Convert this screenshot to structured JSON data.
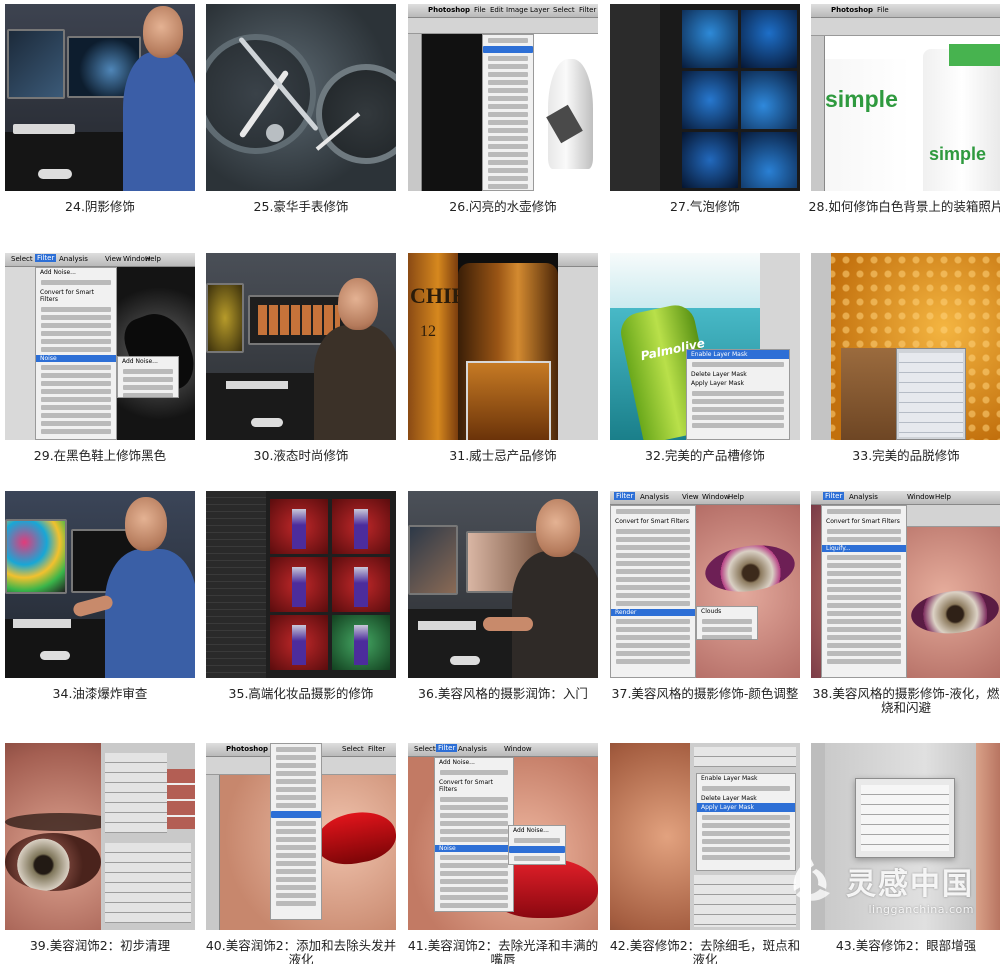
{
  "tutorials": [
    {
      "caption": "24.阴影修饰"
    },
    {
      "caption": "25.豪华手表修饰"
    },
    {
      "caption": "26.闪亮的水壶修饰"
    },
    {
      "caption": "27.气泡修饰"
    },
    {
      "caption": "28.如何修饰白色背景上的装箱照片"
    },
    {
      "caption": "29.在黑色鞋上修饰黑色"
    },
    {
      "caption": "30.液态时尚修饰"
    },
    {
      "caption": "31.威士忌产品修饰"
    },
    {
      "caption": "32.完美的产品槽修饰"
    },
    {
      "caption": "33.完美的品脱修饰"
    },
    {
      "caption": "34.油漆爆炸审查"
    },
    {
      "caption": "35.高端化妆品摄影的修饰"
    },
    {
      "caption": "36.美容风格的摄影润饰：入门"
    },
    {
      "caption": "37.美容风格的摄影修饰-颜色调整"
    },
    {
      "caption": "38.美容风格的摄影修饰-液化，燃烧和闪避"
    },
    {
      "caption": "39.美容润饰2：初步清理"
    },
    {
      "caption": "40.美容润饰2：添加和去除头发并液化"
    },
    {
      "caption": "41.美容润饰2：去除光泽和丰满的嘴唇"
    },
    {
      "caption": "42.美容修饰2：去除细毛，斑点和液化"
    },
    {
      "caption": "43.美容修饰2：眼部增强"
    }
  ],
  "screens": {
    "photoshop": "Photoshop",
    "file": "File",
    "edit": "Edit",
    "image": "Image",
    "layer": "Layer",
    "select": "Select",
    "filter": "Filter",
    "analysis": "Analysis",
    "view": "View",
    "window": "Window",
    "help": "Help",
    "add_noise": "Add Noise...",
    "convert_smart": "Convert for Smart Filters",
    "noise": "Noise",
    "enable_mask": "Enable Layer Mask",
    "delete_mask": "Delete Layer Mask",
    "apply_mask": "Apply Layer Mask",
    "render": "Render",
    "clouds": "Clouds",
    "liquify": "Liquify...",
    "palmolive": "Palmolive",
    "simple": "simple",
    "whisky": "CHIE",
    "whisky_age": "12"
  },
  "watermark": {
    "title": "灵感中国",
    "subtitle": "lingganchina.com"
  },
  "colors": {
    "caption_text": "#222222",
    "ps_highlight": "#2d6fd6"
  }
}
